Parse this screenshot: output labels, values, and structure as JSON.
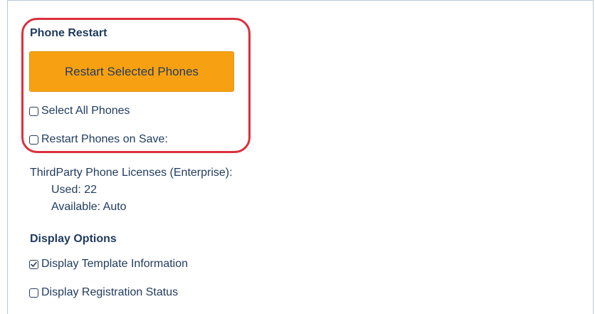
{
  "phone_restart": {
    "title": "Phone Restart",
    "restart_button": "Restart Selected Phones",
    "select_all": {
      "label": "Select All Phones",
      "checked": false
    },
    "restart_on_save": {
      "label": "Restart Phones on Save:",
      "checked": false
    }
  },
  "licenses": {
    "title": "ThirdParty Phone Licenses (Enterprise):",
    "used_label": "Used:",
    "used_value": "22",
    "available_label": "Available:",
    "available_value": "Auto"
  },
  "display_options": {
    "title": "Display Options",
    "template_info": {
      "label": "Display Template Information",
      "checked": true
    },
    "registration_status": {
      "label": "Display Registration Status",
      "checked": false
    }
  },
  "colors": {
    "accent_button": "#f7a112",
    "highlight": "#dc2f3d",
    "text": "#1f3a5f"
  }
}
